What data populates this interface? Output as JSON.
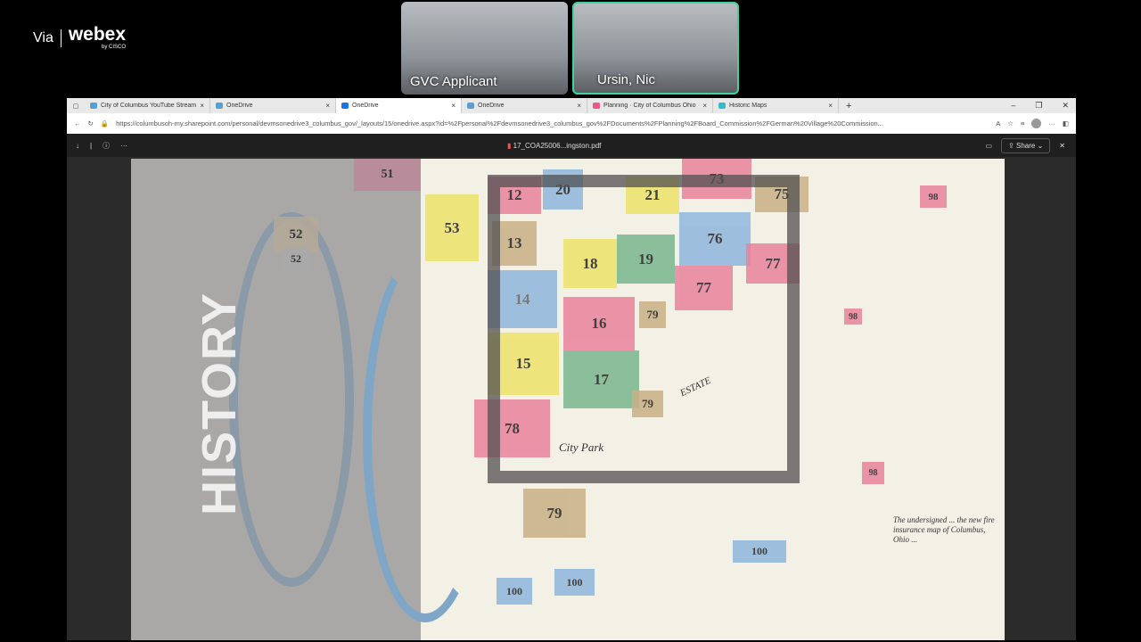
{
  "webex": {
    "via": "Via",
    "brand": "webex",
    "sub": "by CISCO"
  },
  "participants": [
    {
      "name": "GVC Applicant"
    },
    {
      "name": "Ursin, Nic"
    }
  ],
  "browser": {
    "tabs": [
      {
        "label": "City of Columbus YouTube Stream"
      },
      {
        "label": "OneDrive"
      },
      {
        "label": "OneDrive"
      },
      {
        "label": "OneDrive"
      },
      {
        "label": "Planning · City of Columbus Ohio"
      },
      {
        "label": "Historic Maps"
      }
    ],
    "url": "https://columbusoh-my.sharepoint.com/personal/devmsonedrive3_columbus_gov/_layouts/15/onedrive.aspx?id=%2Fpersonal%2Fdevmsonedrive3_columbus_gov%2FDocuments%2FPlanning%2FBoard_Commission%2FGerman%20Village%20Commission..."
  },
  "pdf": {
    "filename": "17_COA25006...ingston.pdf",
    "share": "Share"
  },
  "page": {
    "heading": "HISTORY",
    "blocks": [
      "12",
      "20",
      "21",
      "73",
      "75",
      "53",
      "13",
      "76",
      "18",
      "19",
      "77",
      "77",
      "14",
      "16",
      "79",
      "15",
      "17",
      "79",
      "78",
      "79",
      "100",
      "100",
      "100",
      "98",
      "98",
      "98",
      "51",
      "52",
      "52"
    ],
    "labels": [
      "City Park",
      "ESTATE",
      "The undersigned ... the new fire insurance map of Columbus, Ohio ..."
    ]
  }
}
